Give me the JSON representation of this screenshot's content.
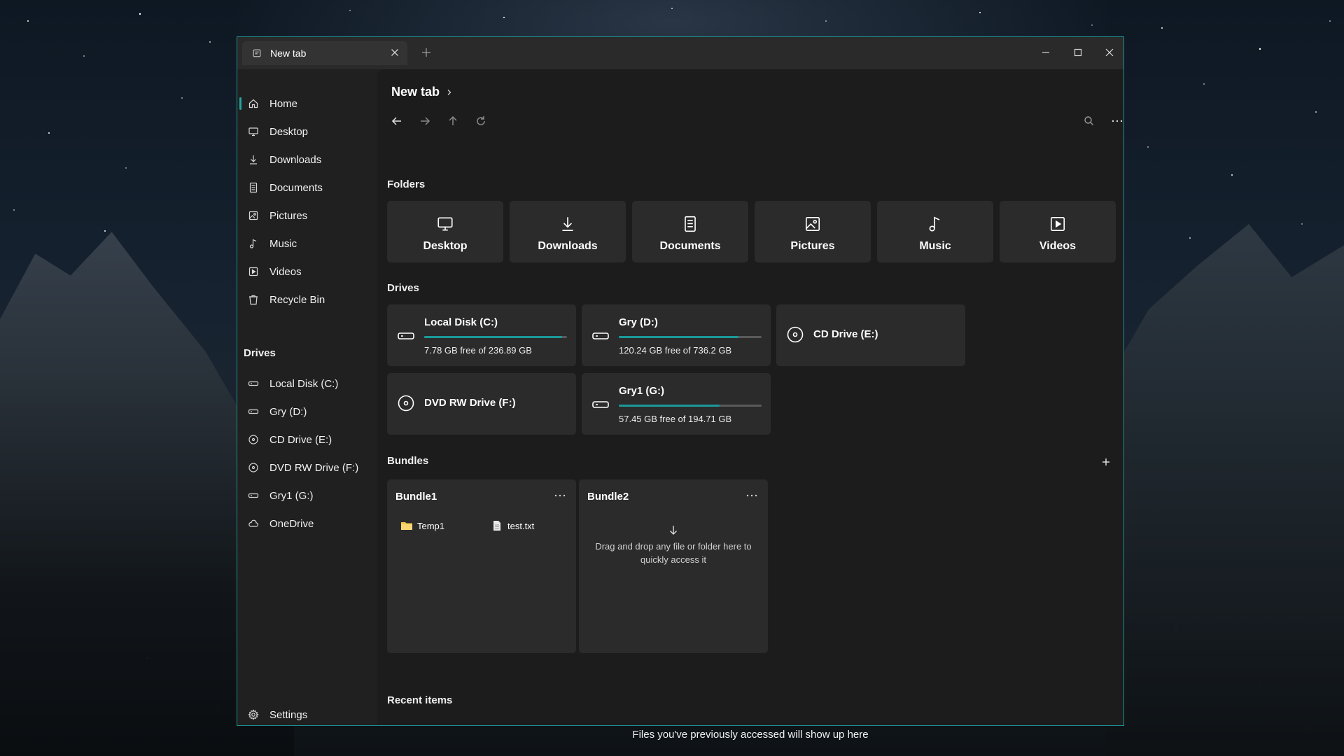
{
  "titlebar": {
    "tab_label": "New tab"
  },
  "sidebar": {
    "items": [
      {
        "label": "Home",
        "icon": "home-icon"
      },
      {
        "label": "Desktop",
        "icon": "desktop-icon"
      },
      {
        "label": "Downloads",
        "icon": "download-icon"
      },
      {
        "label": "Documents",
        "icon": "document-icon"
      },
      {
        "label": "Pictures",
        "icon": "picture-icon"
      },
      {
        "label": "Music",
        "icon": "music-icon"
      },
      {
        "label": "Videos",
        "icon": "video-icon"
      },
      {
        "label": "Recycle Bin",
        "icon": "recycle-bin-icon"
      }
    ],
    "drives_header": "Drives",
    "drives": [
      {
        "label": "Local Disk (C:)",
        "icon": "drive-icon"
      },
      {
        "label": "Gry (D:)",
        "icon": "drive-icon"
      },
      {
        "label": "CD Drive (E:)",
        "icon": "disc-icon"
      },
      {
        "label": "DVD RW Drive (F:)",
        "icon": "disc-icon"
      },
      {
        "label": "Gry1 (G:)",
        "icon": "drive-icon"
      },
      {
        "label": "OneDrive",
        "icon": "cloud-icon"
      }
    ],
    "settings_label": "Settings"
  },
  "main": {
    "breadcrumb": "New tab",
    "folders_title": "Folders",
    "folders": [
      {
        "label": "Desktop",
        "icon": "desktop-icon"
      },
      {
        "label": "Downloads",
        "icon": "download-icon"
      },
      {
        "label": "Documents",
        "icon": "document-icon"
      },
      {
        "label": "Pictures",
        "icon": "picture-icon"
      },
      {
        "label": "Music",
        "icon": "music-icon"
      },
      {
        "label": "Videos",
        "icon": "video-icon"
      }
    ],
    "drives_title": "Drives",
    "drives": [
      {
        "name": "Local Disk (C:)",
        "free": "7.78 GB free of 236.89 GB",
        "used_fraction": 0.967
      },
      {
        "name": "Gry (D:)",
        "free": "120.24 GB free of 736.2 GB",
        "used_fraction": 0.837
      },
      {
        "name": "CD Drive (E:)"
      },
      {
        "name": "DVD RW Drive (F:)"
      },
      {
        "name": "Gry1 (G:)",
        "free": "57.45 GB free of 194.71 GB",
        "used_fraction": 0.705
      }
    ],
    "bundles_title": "Bundles",
    "bundles": [
      {
        "name": "Bundle1",
        "items": [
          {
            "label": "Temp1",
            "icon": "folder-icon"
          },
          {
            "label": "test.txt",
            "icon": "file-icon"
          }
        ]
      },
      {
        "name": "Bundle2",
        "empty_text": "Drag and drop any file or folder here to quickly access it"
      }
    ],
    "recent_title": "Recent items",
    "recent_empty": "Files you've previously accessed will show up here"
  },
  "colors": {
    "accent": "#1a9a9a",
    "window_border": "#1f8f8f",
    "card": "#2b2b2b"
  }
}
